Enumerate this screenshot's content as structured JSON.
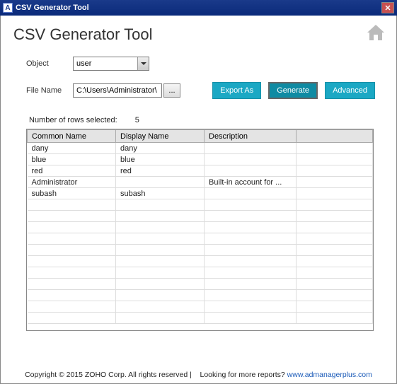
{
  "titlebar": {
    "icon_letter": "A",
    "title": "CSV Generator Tool"
  },
  "header": {
    "page_title": "CSV Generator Tool"
  },
  "form": {
    "object_label": "Object",
    "object_value": "user",
    "filename_label": "File Name",
    "filename_value": "C:\\Users\\Administrator\\",
    "browse_label": "..."
  },
  "buttons": {
    "export": "Export As",
    "generate": "Generate",
    "advanced": "Advanced"
  },
  "rows_info": {
    "label": "Number of rows selected:",
    "count": "5"
  },
  "table": {
    "columns": [
      "Common Name",
      "Display Name",
      "Description",
      ""
    ],
    "rows": [
      {
        "common": "dany",
        "display": "dany",
        "desc": ""
      },
      {
        "common": "blue",
        "display": "blue",
        "desc": ""
      },
      {
        "common": "red",
        "display": "red",
        "desc": ""
      },
      {
        "common": "Administrator",
        "display": "",
        "desc": "Built-in account for ..."
      },
      {
        "common": "subash",
        "display": "subash",
        "desc": ""
      }
    ]
  },
  "footer": {
    "copyright": "Copyright © 2015 ZOHO Corp. All rights reserved |",
    "looking": "Looking for more reports?",
    "link_text": "www.admanagerplus.com"
  }
}
